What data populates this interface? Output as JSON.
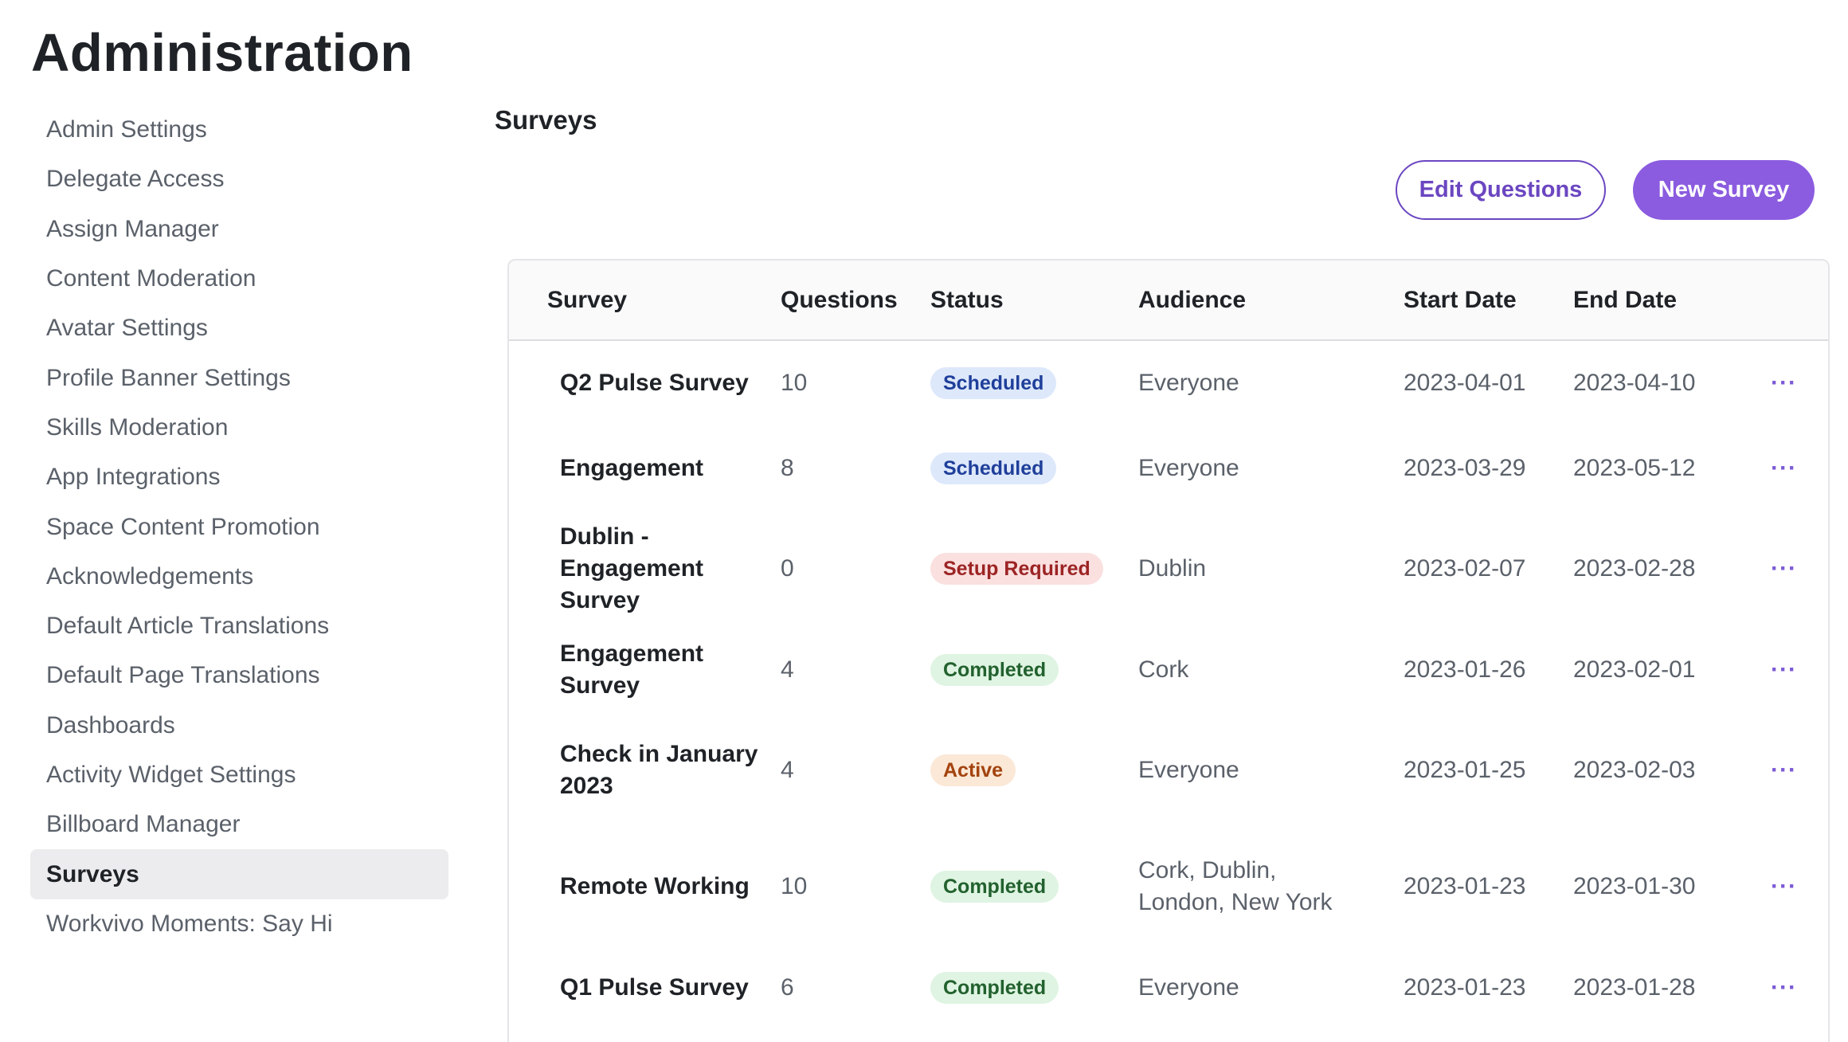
{
  "page": {
    "title": "Administration"
  },
  "sidebar": {
    "items": [
      {
        "label": "Admin Settings"
      },
      {
        "label": "Delegate Access"
      },
      {
        "label": "Assign Manager"
      },
      {
        "label": "Content Moderation"
      },
      {
        "label": "Avatar Settings"
      },
      {
        "label": "Profile Banner Settings"
      },
      {
        "label": "Skills Moderation"
      },
      {
        "label": "App Integrations"
      },
      {
        "label": "Space Content Promotion"
      },
      {
        "label": "Acknowledgements"
      },
      {
        "label": "Default Article Translations"
      },
      {
        "label": "Default Page Translations"
      },
      {
        "label": "Dashboards"
      },
      {
        "label": "Activity Widget Settings"
      },
      {
        "label": "Billboard Manager"
      },
      {
        "label": "Surveys",
        "active": true
      },
      {
        "label": "Workvivo Moments: Say Hi"
      }
    ]
  },
  "main": {
    "section_title": "Surveys",
    "edit_questions_label": "Edit Questions",
    "new_survey_label": "New Survey"
  },
  "table": {
    "headers": {
      "survey": "Survey",
      "questions": "Questions",
      "status": "Status",
      "audience": "Audience",
      "start_date": "Start Date",
      "end_date": "End Date"
    },
    "rows": [
      {
        "survey": [
          "Q2 Pulse Survey"
        ],
        "questions": "10",
        "status": "Scheduled",
        "status_kind": "scheduled",
        "audience": [
          "Everyone"
        ],
        "start": "2023-04-01",
        "end": "2023-04-10",
        "more": "···"
      },
      {
        "survey": [
          "Engagement"
        ],
        "questions": "8",
        "status": "Scheduled",
        "status_kind": "scheduled",
        "audience": [
          "Everyone"
        ],
        "start": "2023-03-29",
        "end": "2023-05-12",
        "more": "···"
      },
      {
        "survey": [
          "Dublin -",
          "Engagement Survey"
        ],
        "questions": "0",
        "status": "Setup Required",
        "status_kind": "setup",
        "audience": [
          "Dublin"
        ],
        "start": "2023-02-07",
        "end": "2023-02-28",
        "more": "···"
      },
      {
        "survey": [
          "Engagement Survey"
        ],
        "questions": "4",
        "status": "Completed",
        "status_kind": "completed",
        "audience": [
          "Cork"
        ],
        "start": "2023-01-26",
        "end": "2023-02-01",
        "more": "···"
      },
      {
        "survey": [
          "Check in January",
          "2023"
        ],
        "questions": "4",
        "status": "Active",
        "status_kind": "active",
        "audience": [
          "Everyone"
        ],
        "start": "2023-01-25",
        "end": "2023-02-03",
        "more": "···"
      },
      {
        "survey": [
          "Remote Working"
        ],
        "questions": "10",
        "status": "Completed",
        "status_kind": "completed",
        "audience": [
          "Cork, Dublin,",
          "London, New York"
        ],
        "start": "2023-01-23",
        "end": "2023-01-30",
        "more": "···"
      },
      {
        "survey": [
          "Q1 Pulse Survey"
        ],
        "questions": "6",
        "status": "Completed",
        "status_kind": "completed",
        "audience": [
          "Everyone"
        ],
        "start": "2023-01-23",
        "end": "2023-01-28",
        "more": "···"
      }
    ]
  }
}
